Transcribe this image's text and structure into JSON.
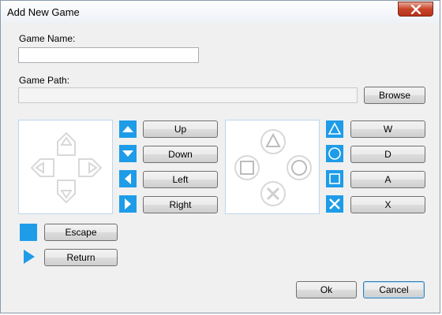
{
  "window": {
    "title": "Add New Game",
    "close_icon": "close-icon"
  },
  "form": {
    "game_name_label": "Game Name:",
    "game_name_value": "",
    "game_path_label": "Game Path:",
    "game_path_value": "",
    "browse_label": "Browse"
  },
  "dpad": {
    "up_label": "Up",
    "down_label": "Down",
    "left_label": "Left",
    "right_label": "Right"
  },
  "face": {
    "triangle_label": "W",
    "circle_label": "D",
    "square_label": "A",
    "cross_label": "X"
  },
  "system": {
    "escape_label": "Escape",
    "return_label": "Return"
  },
  "footer": {
    "ok_label": "Ok",
    "cancel_label": "Cancel"
  },
  "colors": {
    "accent": "#1e9ce8",
    "pad_border": "#bdd6ef",
    "pad_glyph": "#d8d8d8"
  }
}
